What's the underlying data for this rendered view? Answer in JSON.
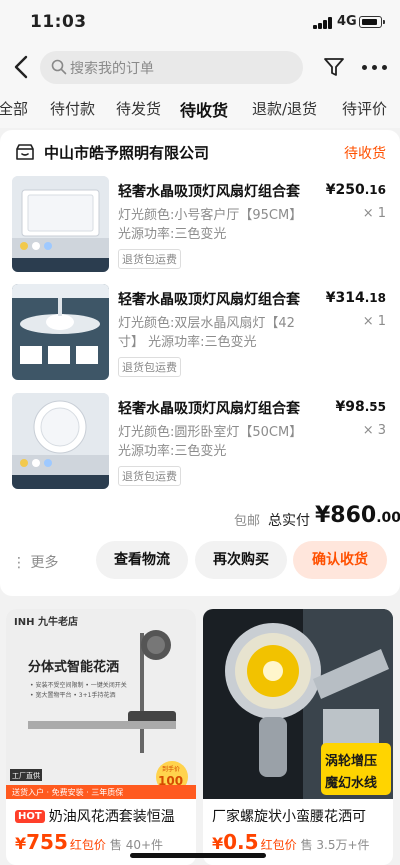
{
  "status_bar": {
    "time": "11:03",
    "network": "4G"
  },
  "header": {
    "search_placeholder": "搜索我的订单"
  },
  "tabs": [
    "全部",
    "待付款",
    "待发货",
    "待收货",
    "退款/退货",
    "待评价"
  ],
  "active_tab": "待收货",
  "order": {
    "shop_name": "中山市皓予照明有限公司",
    "status": "待收货",
    "items": [
      {
        "title": "轻奢水晶吸顶灯风扇灯组合套",
        "spec": "灯光颜色:小号客户厅【95CM】光源功率:三色变光",
        "price_main": "¥250",
        "price_dec": ".16",
        "qty": "× 1",
        "badge": "退货包运费"
      },
      {
        "title": "轻奢水晶吸顶灯风扇灯组合套",
        "spec": "灯光颜色:双层水晶风扇灯【42寸】 光源功率:三色变光",
        "price_main": "¥314",
        "price_dec": ".18",
        "qty": "× 1",
        "badge": "退货包运费"
      },
      {
        "title": "轻奢水晶吸顶灯风扇灯组合套",
        "spec": "灯光颜色:圆形卧室灯【50CM】光源功率:三色变光",
        "price_main": "¥98",
        "price_dec": ".55",
        "qty": "× 3",
        "badge": "退货包运费"
      }
    ],
    "free_shipping": "包邮",
    "total_label": "总实付",
    "total_main": "¥860",
    "total_dec": ".00",
    "more": "更多",
    "buttons": {
      "logistics": "查看物流",
      "rebuy": "再次购买",
      "confirm": "确认收货"
    }
  },
  "recommendations": [
    {
      "hot": "HOT",
      "title": "奶油风花洒套装恒温",
      "price": "755",
      "currency": "¥",
      "tag": "红包价",
      "sold": "售 40+件",
      "brand": "INH 九牛老店",
      "headline": "分体式智能花洒",
      "features": [
        "• 安装不受空间限制 • 一键关闭开关",
        "• 宽大置物平台 • 3+1手持花洒"
      ],
      "shop_tag": "工厂直供",
      "promo": "到手价",
      "promo_value": "100",
      "strip": "送货入户 · 免费安装 · 三年质保"
    },
    {
      "hot": "",
      "title": "厂家螺旋状小蛮腰花洒可",
      "price": "0.5",
      "currency": "¥",
      "tag": "红包价",
      "sold": "售 3.5万+件",
      "badge_line1": "涡轮增压",
      "badge_line2": "魔幻水线"
    }
  ],
  "colors": {
    "accent": "#ff5000",
    "price": "#ff4400"
  },
  "icons": [
    "back-icon",
    "search-icon",
    "filter-icon",
    "more-icon",
    "shop-icon"
  ]
}
